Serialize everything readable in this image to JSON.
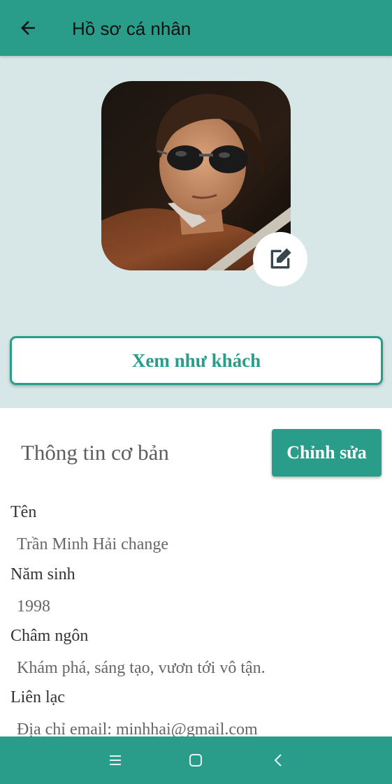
{
  "header": {
    "title": "Hồ sơ cá nhân",
    "back_icon": "arrow-left-icon"
  },
  "profile": {
    "edit_avatar_icon": "edit-square-icon",
    "view_as_guest_label": "Xem như khách"
  },
  "basic_info": {
    "section_title": "Thông tin cơ bản",
    "edit_label": "Chỉnh sửa",
    "fields": [
      {
        "label": "Tên",
        "value": "Trần Minh Hải change"
      },
      {
        "label": "Năm sinh",
        "value": "1998"
      },
      {
        "label": "Châm ngôn",
        "value": "Khám phá, sáng tạo, vươn tới vô tận."
      },
      {
        "label": "Liên lạc",
        "value": "Địa chỉ email: minhhai@gmail.com"
      }
    ]
  },
  "navbar": {
    "icons": [
      "recent-apps-icon",
      "home-icon",
      "back-icon"
    ]
  },
  "colors": {
    "primary": "#2a9d8a",
    "hero_background": "#d7e6e6",
    "edit_icon": "#37474f"
  }
}
